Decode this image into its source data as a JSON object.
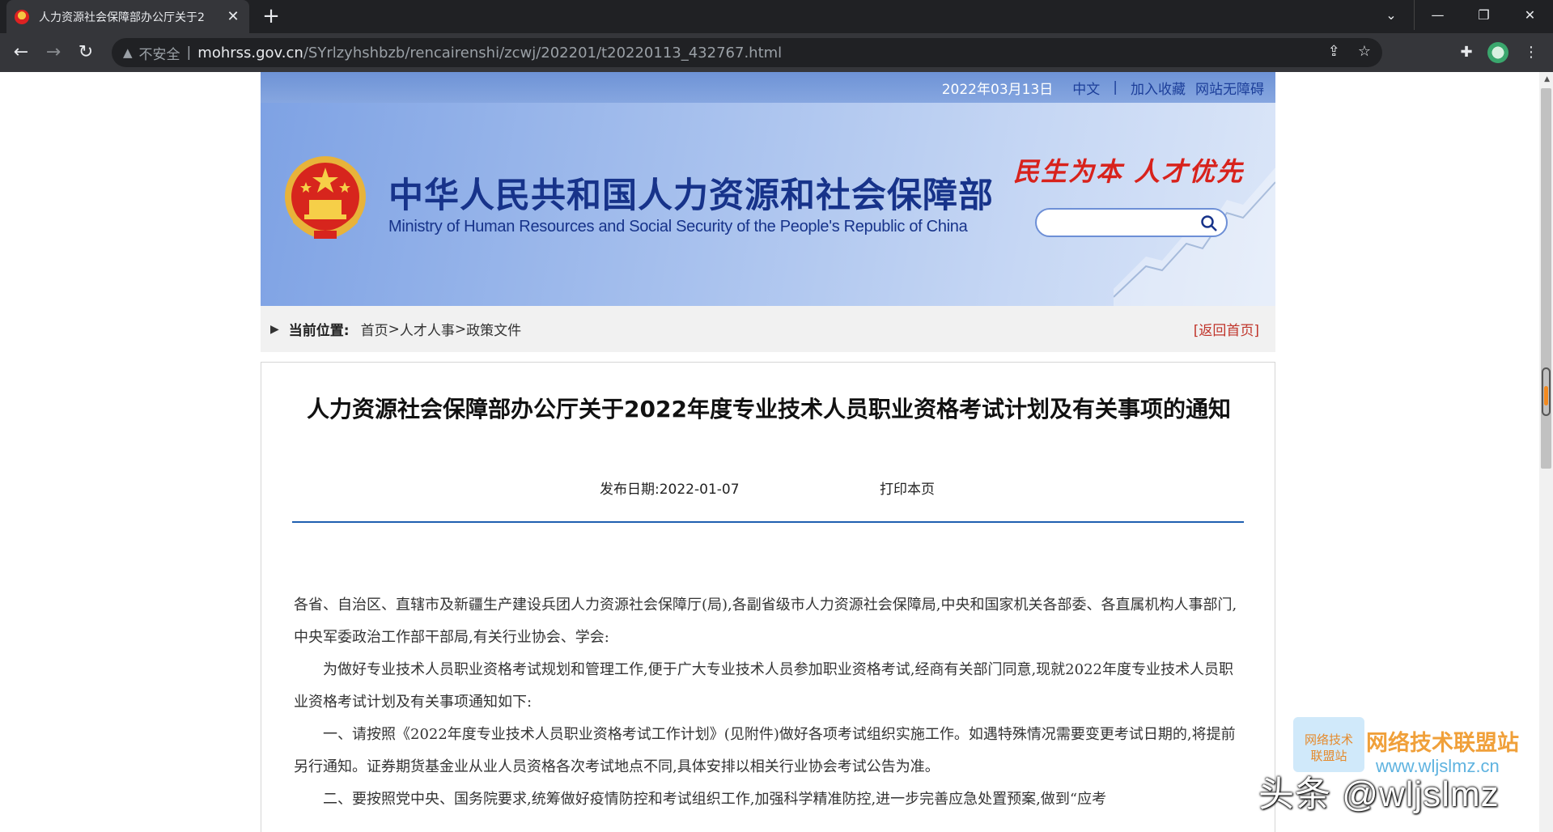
{
  "browser": {
    "tab_title": "人力资源社会保障部办公厅关于2",
    "insecure_label": "不安全",
    "url_host": "mohrss.gov.cn",
    "url_path": "/SYrlzyhshbzb/rencairenshi/zcwj/202201/t20220113_432767.html"
  },
  "header": {
    "date": "2022年03月13日",
    "lang": "中文",
    "separator": "|",
    "favorite": "加入收藏",
    "accessibility": "网站无障碍"
  },
  "banner": {
    "ministry_cn": "中华人民共和国人力资源和社会保障部",
    "ministry_en": "Ministry of Human Resources and Social Security of the People's Republic of China",
    "slogan": "民生为本 人才优先",
    "search_placeholder": ""
  },
  "breadcrumb": {
    "label": "当前位置:",
    "items": [
      "首页",
      "人才人事",
      "政策文件"
    ],
    "sep": ">",
    "back_home": "[返回首页]"
  },
  "article": {
    "title": "人力资源社会保障部办公厅关于2022年度专业技术人员职业资格考试计划及有关事项的通知",
    "publish_date": "发布日期:2022-01-07",
    "print": "打印本页",
    "paragraphs": [
      "各省、自治区、直辖市及新疆生产建设兵团人力资源社会保障厅(局),各副省级市人力资源社会保障局,中央和国家机关各部委、各直属机构人事部门,中央军委政治工作部干部局,有关行业协会、学会:",
      "为做好专业技术人员职业资格考试规划和管理工作,便于广大专业技术人员参加职业资格考试,经商有关部门同意,现就2022年度专业技术人员职业资格考试计划及有关事项通知如下:",
      "一、请按照《2022年度专业技术人员职业资格考试工作计划》(见附件)做好各项考试组织实施工作。如遇特殊情况需要变更考试日期的,将提前另行通知。证券期货基金业从业人员资格各次考试地点不同,具体安排以相关行业协会考试公告为准。",
      "二、要按照党中央、国务院要求,统筹做好疫情防控和考试组织工作,加强科学精准防控,进一步完善应急处置预案,做到“应考"
    ]
  },
  "watermark": {
    "logo_text": "网络技术联盟站",
    "title": "网络技术联盟站",
    "url": "www.wljslmz.cn",
    "handle": "头条 @wljslmz"
  },
  "colors": {
    "header_link": "#1d3f9a",
    "ministry_text": "#17338a",
    "slogan": "#d8221c",
    "rule": "#1f5fb0",
    "back_home": "#c0342a"
  }
}
